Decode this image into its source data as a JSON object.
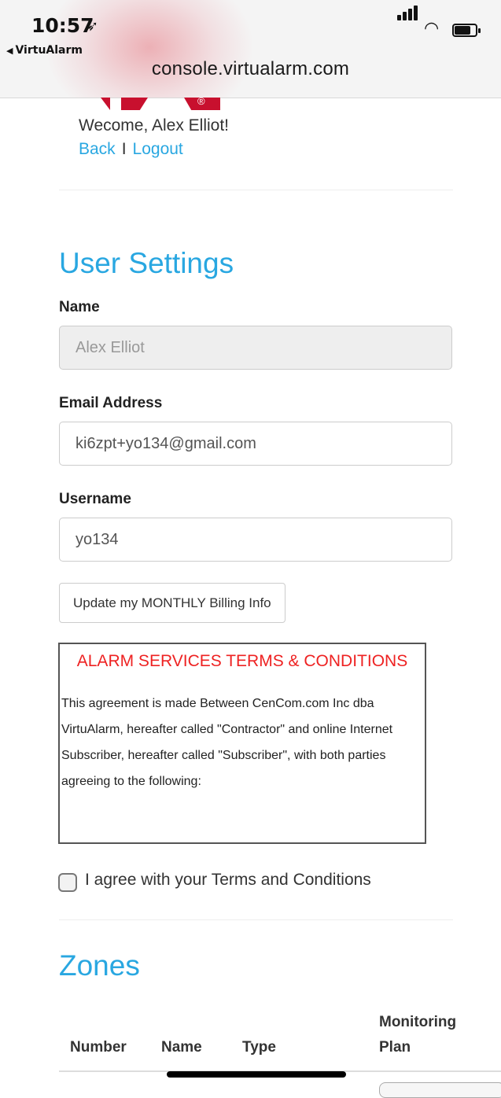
{
  "status_bar": {
    "time": "10:57",
    "location_icon": "location-arrow-icon",
    "back_app": "VirtuAlarm",
    "signal_icon": "cellular-signal-icon",
    "wifi_icon": "wifi-icon",
    "battery_icon": "battery-icon"
  },
  "address_bar": {
    "url": "console.virtualarm.com"
  },
  "header": {
    "welcome": "Wecome, Alex Elliot!",
    "back_link": "Back",
    "separator": "I",
    "logout_link": "Logout"
  },
  "user_settings": {
    "title": "User Settings",
    "name": {
      "label": "Name",
      "value": "Alex Elliot"
    },
    "email": {
      "label": "Email Address",
      "value": "ki6zpt+yo134@gmail.com"
    },
    "username": {
      "label": "Username",
      "value": "yo134"
    },
    "billing_button": "Update my MONTHLY Billing Info",
    "terms": {
      "title": "ALARM SERVICES TERMS & CONDITIONS",
      "text": "This agreement is made Between CenCom.com Inc dba VirtuAlarm, hereafter called \"Contractor\" and online Internet Subscriber, hereafter called \"Subscriber\", with both parties agreeing to the following:"
    },
    "agree_label": "I agree with your Terms and Conditions",
    "agree_checked": false
  },
  "zones": {
    "title": "Zones",
    "columns": [
      "Number",
      "Name",
      "Type",
      "Monitoring Plan"
    ]
  },
  "colors": {
    "accent": "#29a7e1",
    "terms_title": "#ee2222",
    "logo": "#c8102e"
  }
}
